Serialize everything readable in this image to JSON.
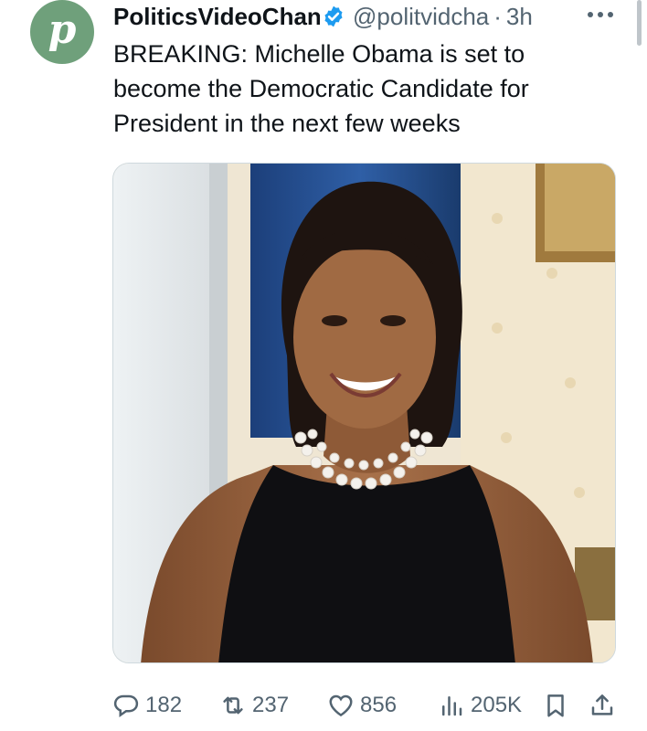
{
  "tweet": {
    "avatar_letter": "p",
    "display_name": "PoliticsVideoChannel",
    "handle": "@politvidcha",
    "separator": "·",
    "time": "3h",
    "text": "BREAKING: Michelle Obama is set to become the Democratic Candidate for President in the next few weeks"
  },
  "media": {
    "description_icon": "portrait-photo"
  },
  "actions": {
    "replies": "182",
    "reposts": "237",
    "likes": "856",
    "views": "205K"
  },
  "colors": {
    "avatar_bg": "#6fa07b",
    "verified": "#1d9bf0",
    "secondary_text": "#536471"
  }
}
